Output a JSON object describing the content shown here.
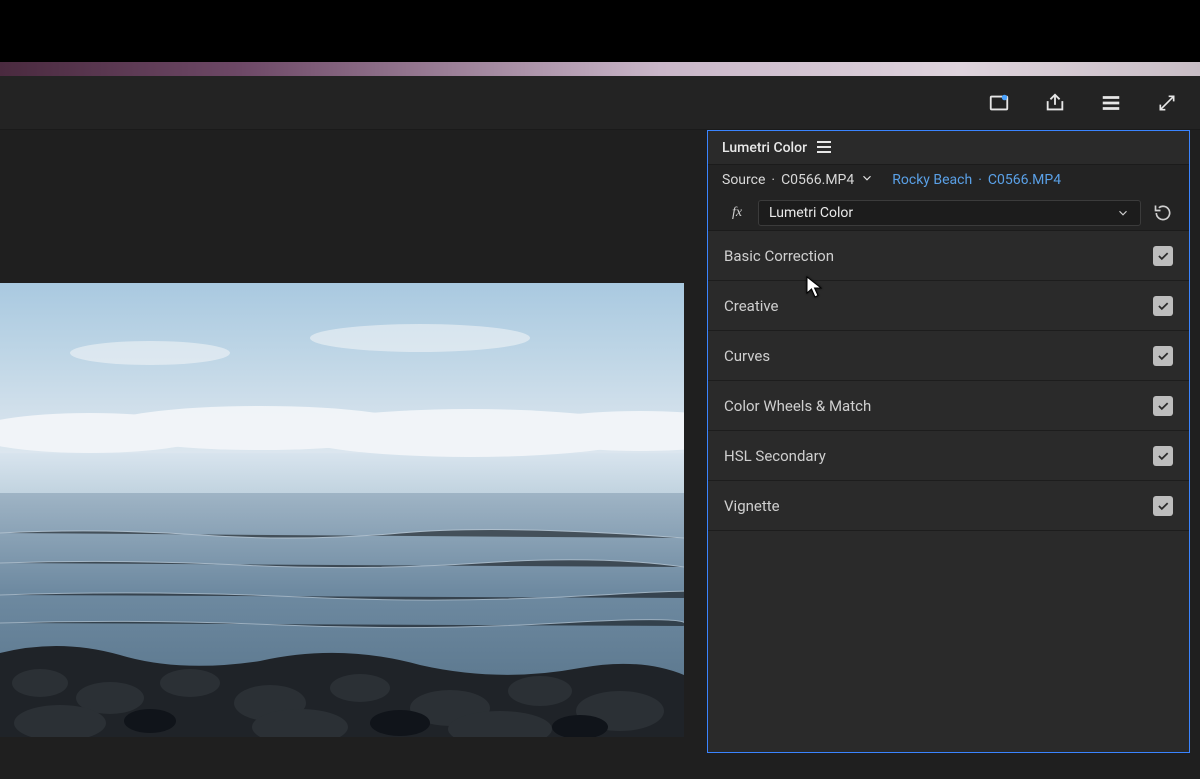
{
  "toolbar": {
    "icons": [
      "full-screen-toggle-icon",
      "export-icon",
      "panel-menu-icon",
      "maximize-icon"
    ]
  },
  "panel": {
    "title": "Lumetri Color",
    "source_prefix": "Source",
    "source_file": "C0566.MP4",
    "sequence_name": "Rocky Beach",
    "sequence_clip": "C0566.MP4",
    "effect_label": "Lumetri Color",
    "sections": [
      {
        "label": "Basic Correction",
        "checked": true
      },
      {
        "label": "Creative",
        "checked": true
      },
      {
        "label": "Curves",
        "checked": true
      },
      {
        "label": "Color Wheels & Match",
        "checked": true
      },
      {
        "label": "HSL Secondary",
        "checked": true
      },
      {
        "label": "Vignette",
        "checked": true
      }
    ]
  }
}
